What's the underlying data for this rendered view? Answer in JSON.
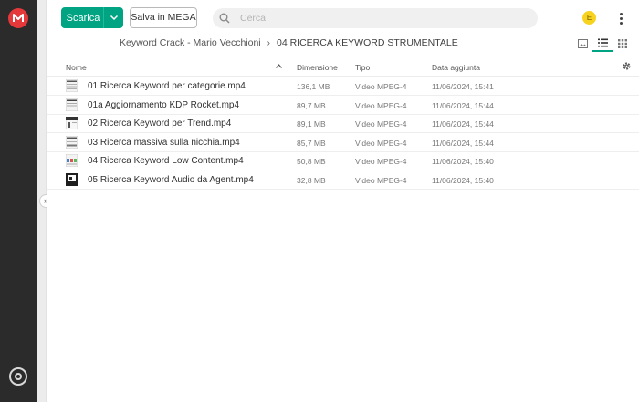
{
  "sidebar": {
    "logo_icon": "mega-logo-icon",
    "bottom_icon": "sync-icon",
    "accent": "#e5383b"
  },
  "toolbar": {
    "download_label": "Scarica",
    "save_label": "Salva in MEGA",
    "search_placeholder": "Cerca",
    "avatar_letter": "E",
    "brand_color": "#00a382"
  },
  "breadcrumb": {
    "parent": "Keyword Crack - Mario Vecchioni",
    "current": "04 RICERCA KEYWORD STRUMENTALE"
  },
  "table": {
    "headers": {
      "name": "Nome",
      "size": "Dimensione",
      "type": "Tipo",
      "date": "Data aggiunta"
    },
    "rows": [
      {
        "name": "01 Ricerca Keyword per categorie.mp4",
        "size": "136,1 MB",
        "type": "Video MPEG-4",
        "date": "11/06/2024, 15:41",
        "thumb": "light"
      },
      {
        "name": "01a Aggiornamento KDP Rocket.mp4",
        "size": "89,7 MB",
        "type": "Video MPEG-4",
        "date": "11/06/2024, 15:44",
        "thumb": "light"
      },
      {
        "name": "02 Ricerca Keyword per Trend.mp4",
        "size": "89,1 MB",
        "type": "Video MPEG-4",
        "date": "11/06/2024, 15:44",
        "thumb": "dark-top"
      },
      {
        "name": "03 Ricerca massiva sulla nicchia.mp4",
        "size": "85,7 MB",
        "type": "Video MPEG-4",
        "date": "11/06/2024, 15:44",
        "thumb": "light"
      },
      {
        "name": "04 Ricerca Keyword Low Content.mp4",
        "size": "50,8 MB",
        "type": "Video MPEG-4",
        "date": "11/06/2024, 15:40",
        "thumb": "color"
      },
      {
        "name": "05 Ricerca Keyword Audio da Agent.mp4",
        "size": "32,8 MB",
        "type": "Video MPEG-4",
        "date": "11/06/2024, 15:40",
        "thumb": "dark"
      }
    ]
  }
}
